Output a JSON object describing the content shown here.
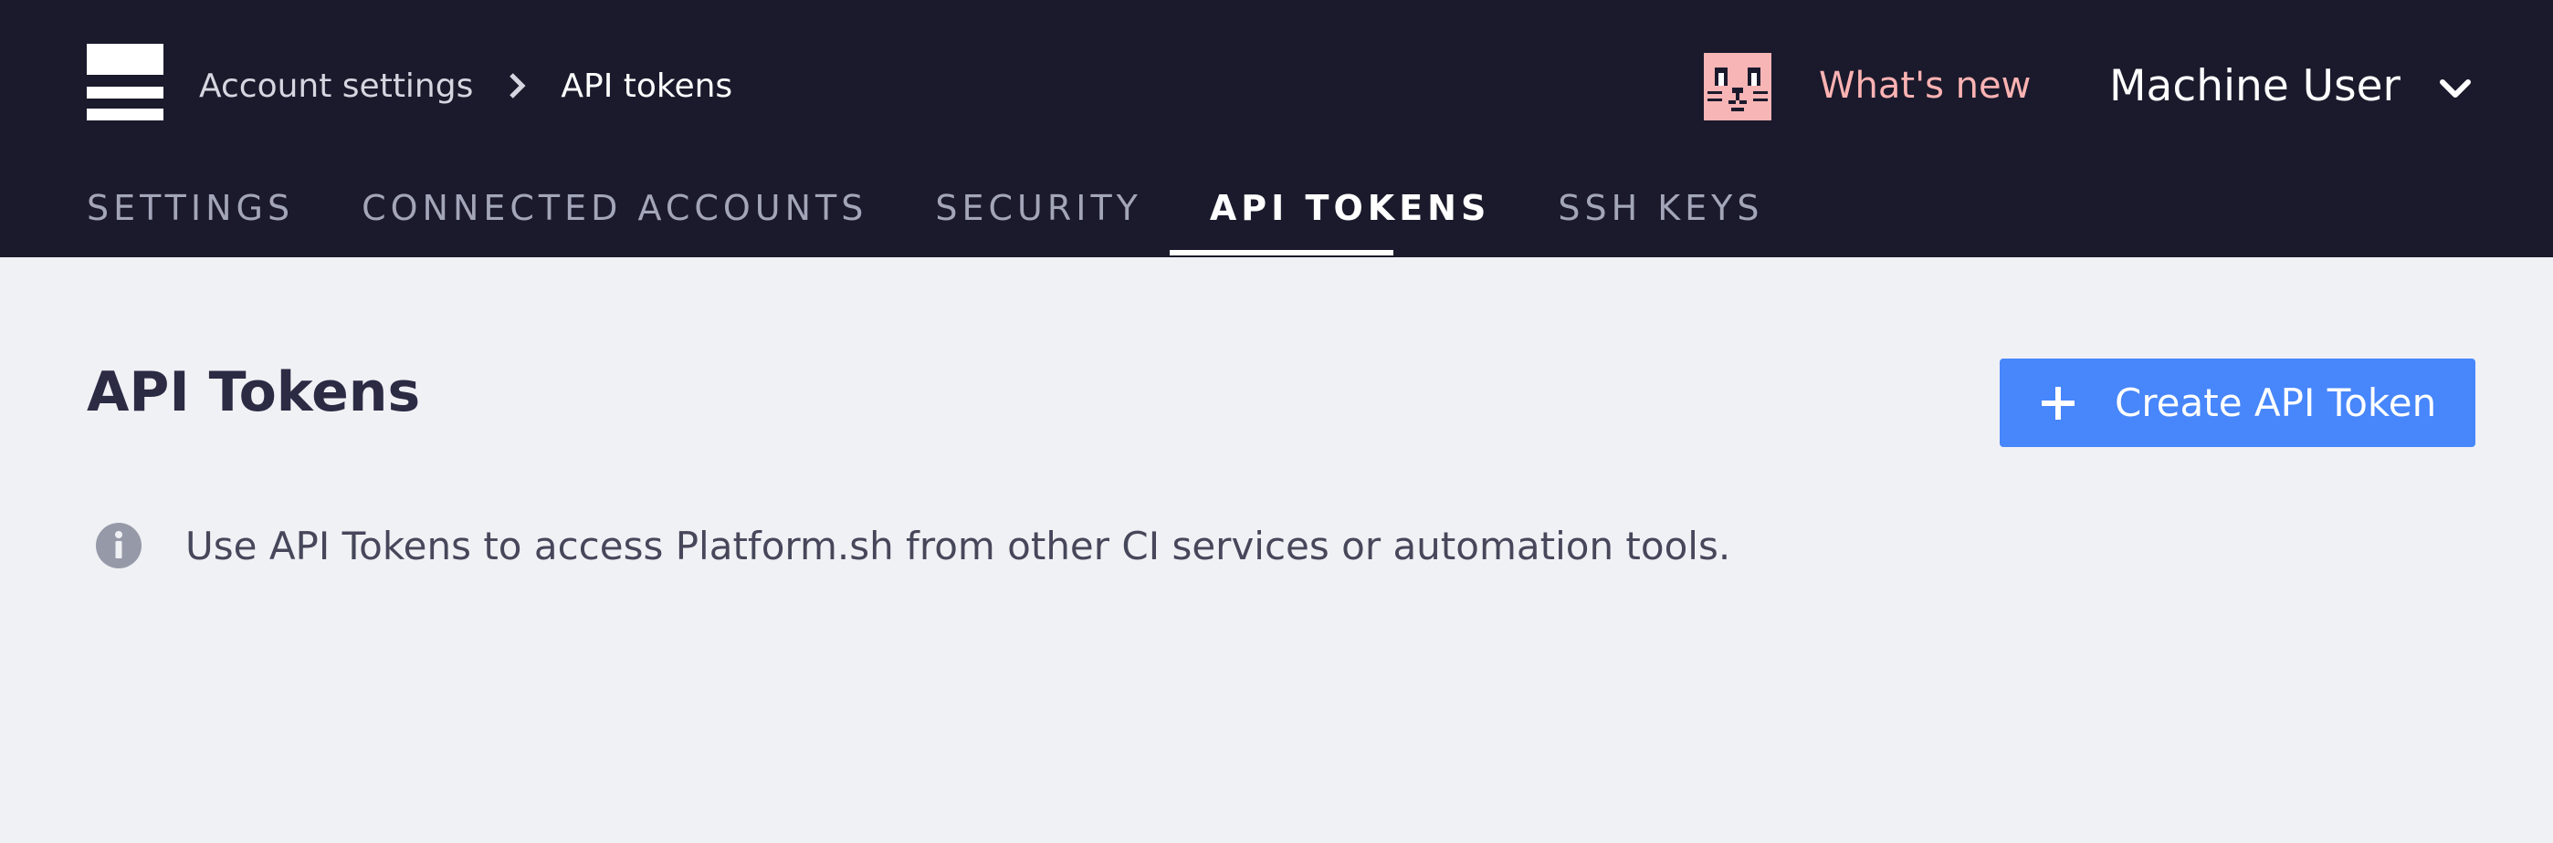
{
  "header": {
    "breadcrumb": {
      "parent": "Account settings",
      "current": "API tokens"
    },
    "whats_new": "What's new",
    "user_name": "Machine User"
  },
  "tabs": [
    {
      "label": "SETTINGS",
      "active": false
    },
    {
      "label": "CONNECTED ACCOUNTS",
      "active": false
    },
    {
      "label": "SECURITY",
      "active": false
    },
    {
      "label": "API TOKENS",
      "active": true
    },
    {
      "label": "SSH KEYS",
      "active": false
    }
  ],
  "main": {
    "title": "API Tokens",
    "create_button": "Create API Token",
    "info_text": "Use API Tokens to access Platform.sh from other CI services or automation tools."
  },
  "icons": {
    "logo": "platform-logo-icon",
    "breadcrumb_separator": "chevron-right-icon",
    "avatar": "cat-avatar-icon",
    "user_menu": "chevron-down-icon",
    "create": "plus-icon",
    "info": "info-icon"
  },
  "colors": {
    "header_bg": "#1b1a2c",
    "page_bg": "#f0f1f5",
    "accent": "#4786fb",
    "whats_new": "#ffb3b3",
    "avatar_bg": "#f7b5b5"
  }
}
